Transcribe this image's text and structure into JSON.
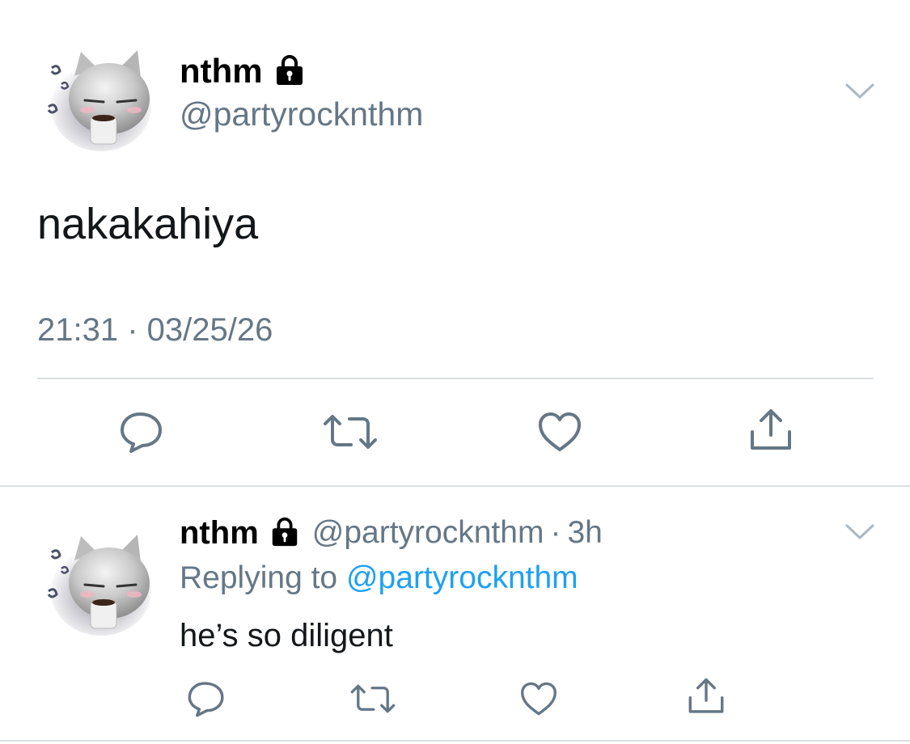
{
  "main_tweet": {
    "display_name": "nthm",
    "handle": "@partyrocknthm",
    "text": "nakakahiya",
    "timestamp": "21:31 · 03/25/26",
    "icons": {
      "lock": "lock-icon",
      "menu": "chevron-down-icon",
      "reply": "reply-icon",
      "retweet": "retweet-icon",
      "like": "heart-icon",
      "share": "share-icon"
    }
  },
  "reply_tweet": {
    "display_name": "nthm",
    "handle": "@partyrocknthm",
    "separator": "·",
    "time_ago": "3h",
    "replying_prefix": "Replying to",
    "replying_handle": "@partyrocknthm",
    "text": "he’s so diligent"
  },
  "colors": {
    "text": "#14171a",
    "muted": "#657786",
    "link": "#1da1f2",
    "divider": "#dadfe3",
    "background": "#ffffff"
  }
}
